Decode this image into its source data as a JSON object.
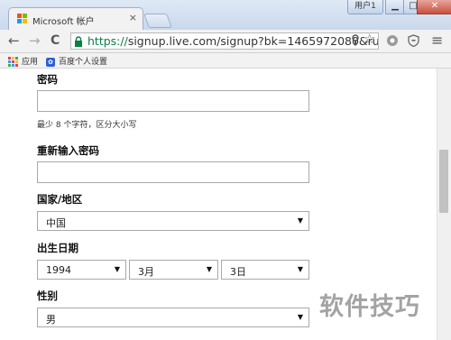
{
  "window": {
    "tab_title": "Microsoft 帐户",
    "tab_close": "×",
    "user_button": "用户1",
    "minimize": "▁",
    "maximize": "□",
    "close": "✕"
  },
  "toolbar": {
    "back": "←",
    "forward": "→",
    "reload": "C",
    "url_scheme": "https://",
    "url_host": "signup.live.com",
    "url_rest": "/signup?bk=1465972080&ru=",
    "menu": "≡"
  },
  "bookmarks": {
    "apps_label": "应用",
    "baidu_label": "百度个人设置"
  },
  "form": {
    "password_label": "密码",
    "password_value": "",
    "password_hint": "最少 8 个字符，区分大小写",
    "reenter_label": "重新输入密码",
    "reenter_value": "",
    "country_label": "国家/地区",
    "country_value": "中国",
    "birthdate_label": "出生日期",
    "birth_year": "1994",
    "birth_month": "3月",
    "birth_day": "3日",
    "gender_label": "性别",
    "gender_value": "男"
  },
  "watermark": "软件技巧",
  "colors": {
    "url_secure_green": "#0b8043",
    "titlebar_blue": "#c9d8ec",
    "close_red": "#c8503c"
  }
}
